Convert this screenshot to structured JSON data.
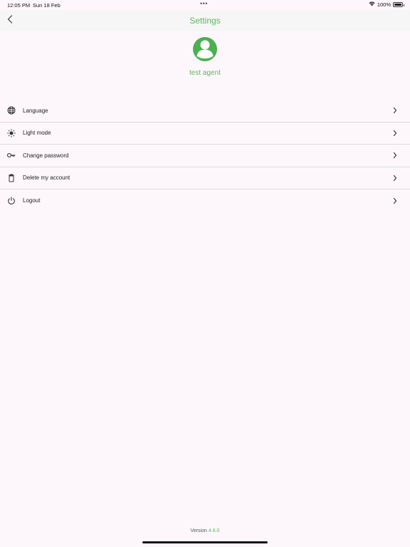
{
  "status_bar": {
    "time": "12:05 PM",
    "date": "Sun 18 Feb",
    "dots": "•••",
    "battery_text": "100%",
    "battery_level": 1.0
  },
  "nav": {
    "title": "Settings",
    "back_icon": "chevron-left-icon"
  },
  "profile": {
    "name": "test agent",
    "avatar_icon": "user-avatar-icon"
  },
  "menu": {
    "items": [
      {
        "label": "Language",
        "icon": "globe-icon"
      },
      {
        "label": "Light mode",
        "icon": "sun-icon"
      },
      {
        "label": "Change password",
        "icon": "key-icon"
      },
      {
        "label": "Delete my account",
        "icon": "trash-icon"
      },
      {
        "label": "Logout",
        "icon": "power-icon"
      }
    ]
  },
  "footer": {
    "version_label": "Version",
    "version_number": "4.6.0"
  },
  "colors": {
    "accent": "#5cb85c",
    "avatar": "#4caf50",
    "background": "#fdf7fc",
    "nav_background": "#f6f6f6"
  }
}
